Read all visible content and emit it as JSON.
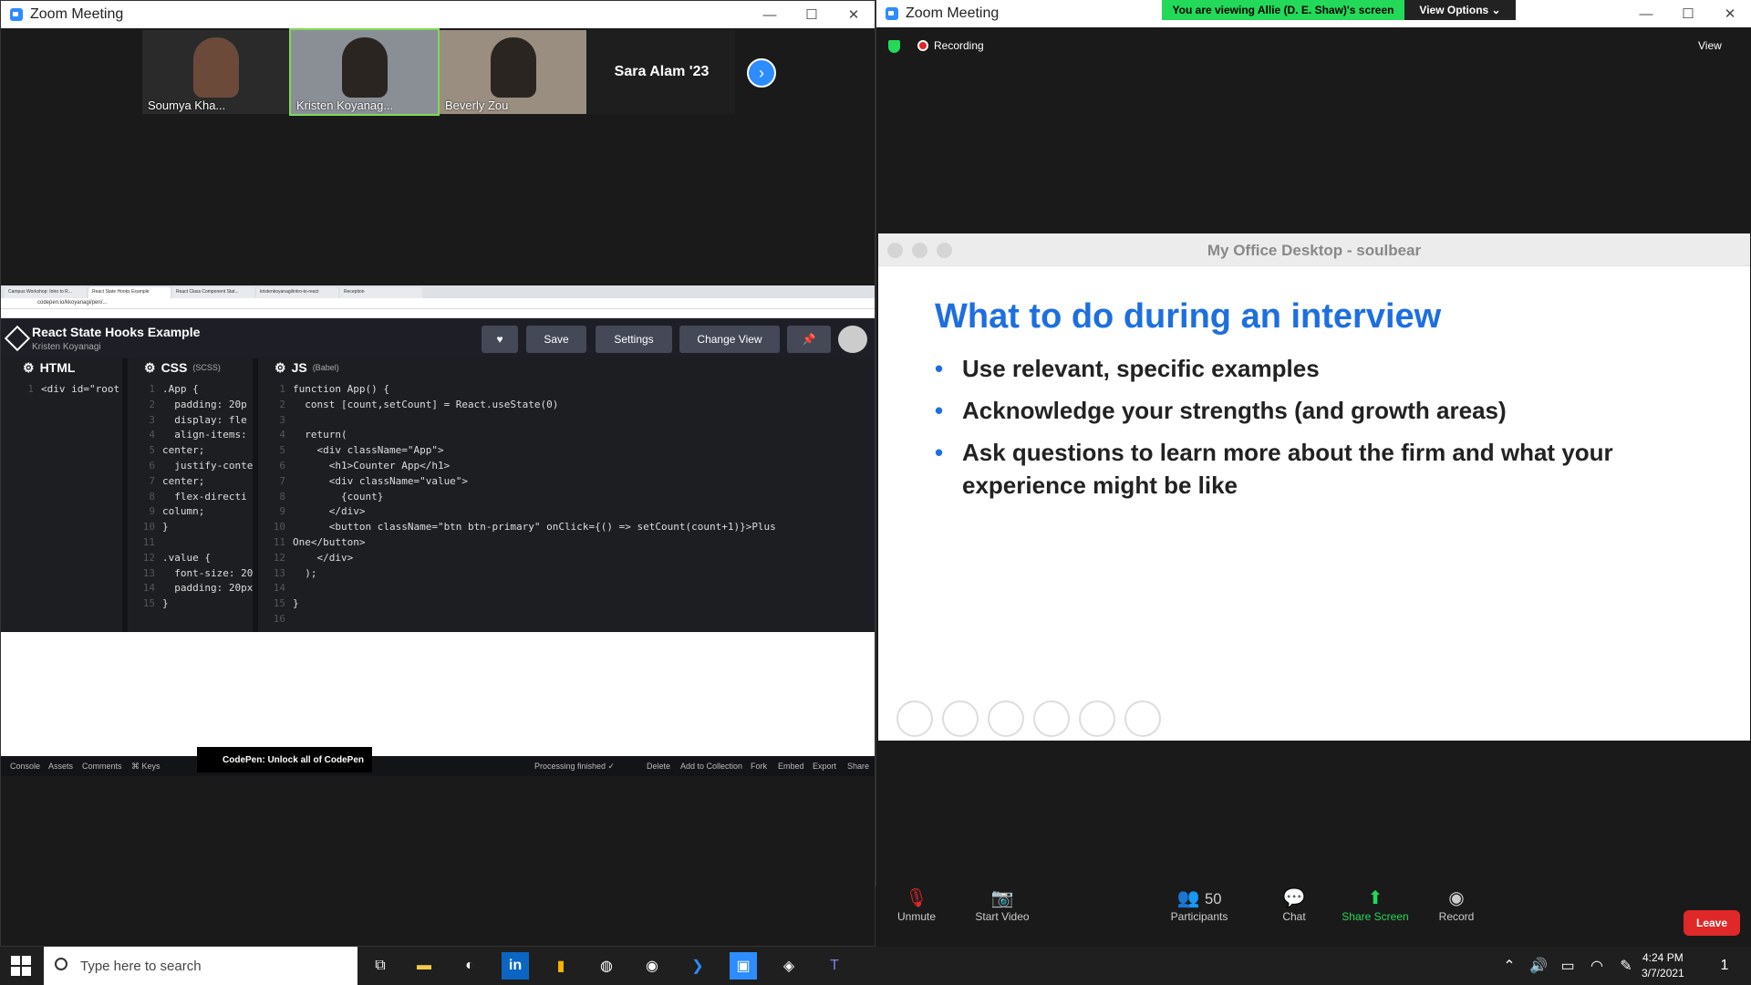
{
  "left_window": {
    "title": "Zoom Meeting",
    "participants": [
      {
        "name": "Soumya Kha...",
        "muted": true
      },
      {
        "name": "Kristen Koyanag...",
        "muted": false,
        "active": true
      },
      {
        "name": "Beverly Zou",
        "muted": true
      },
      {
        "name": "Sara Alam '23"
      }
    ]
  },
  "browser": {
    "tabs": [
      "Campus Workshop: Intro to R...",
      "React State Hooks Example",
      "React Class Component Stat...",
      "kristenkoyanagi/intro-to-react",
      "Reception"
    ],
    "url": "codepen.io/kkoyanagi/pen/..."
  },
  "codepen": {
    "title": "React State Hooks Example",
    "author": "Kristen Koyanagi",
    "buttons": {
      "save": "Save",
      "settings": "Settings",
      "change_view": "Change View"
    },
    "panes": {
      "html": "HTML",
      "css": "CSS",
      "css_sub": "(SCSS)",
      "js": "JS",
      "js_sub": "(Babel)"
    },
    "footer": {
      "console": "Console",
      "assets": "Assets",
      "comments": "Comments",
      "keys": "⌘ Keys",
      "processing": "Processing finished ✓",
      "delete": "Delete",
      "add_collection": "Add to Collection",
      "fork": "Fork",
      "embed": "Embed",
      "export": "Export",
      "share": "Share"
    },
    "promo": "CodePen: Unlock all of CodePen",
    "html_code": [
      "<div id=\"root"
    ],
    "css_code": [
      ".App {",
      "  padding: 20p",
      "  display: fle",
      "  align-items:",
      "center;",
      "  justify-conte",
      "center;",
      "  flex-directi",
      "column;",
      "}",
      "",
      ".value {",
      "  font-size: 20",
      "  padding: 20px",
      "}"
    ],
    "js_code": [
      "function App() {",
      "  const [count,setCount] = React.useState(0)",
      "",
      "  return(",
      "    <div className=\"App\">",
      "      <h1>Counter App</h1>",
      "      <div className=\"value\">",
      "        {count}",
      "      </div>",
      "      <button className=\"btn btn-primary\" onClick={() => setCount(count+1)}>Plus",
      "One</button>",
      "    </div>",
      "  );",
      "",
      "}",
      ""
    ]
  },
  "right_window": {
    "title": "Zoom Meeting",
    "banner": "You are viewing Allie (D. E. Shaw)'s screen",
    "view_options": "View Options ⌄",
    "recording": "Recording",
    "view": "View",
    "remote_window_title": "My Office Desktop - soulbear",
    "slide": {
      "title": "What to do during an interview",
      "bullets": [
        "Use relevant, specific examples",
        "Acknowledge your strengths (and growth areas)",
        "Ask questions to learn more about the firm and what your experience might be like"
      ]
    },
    "toolbar": {
      "unmute": "Unmute",
      "start_video": "Start Video",
      "participants": "Participants",
      "participant_count": "50",
      "chat": "Chat",
      "share_screen": "Share Screen",
      "record": "Record",
      "leave": "Leave"
    }
  },
  "taskbar": {
    "search_placeholder": "Type here to search",
    "time": "4:24 PM",
    "date": "3/7/2021",
    "notification_count": "1"
  },
  "colors": {
    "zoom_blue": "#2d8cff",
    "banner_green": "#23d959",
    "slide_blue": "#1d6fe0",
    "leave_red": "#e02828"
  }
}
